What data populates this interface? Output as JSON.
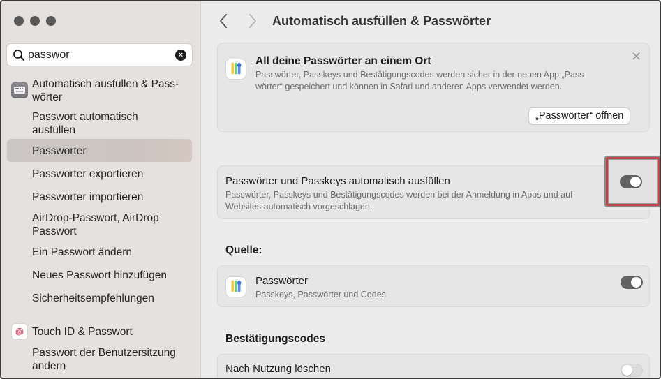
{
  "window": {
    "traffic_lights": [
      "close",
      "minimize",
      "zoom"
    ]
  },
  "sidebar": {
    "search": {
      "value": "passwor",
      "icon": "search-icon",
      "clear_icon": "clear-icon"
    },
    "group1": {
      "label": "Automatisch ausfüllen & Pass-\nwörter",
      "line1": "Automatisch ausfüllen & Pass-",
      "line2": "wörter",
      "icon": "keyboard-icon"
    },
    "items": [
      {
        "line1": "Passwort automatisch",
        "line2": "ausfüllen"
      },
      {
        "line1": "Passwörter"
      },
      {
        "line1": "Passwörter exportieren"
      },
      {
        "line1": "Passwörter importieren"
      },
      {
        "line1": "AirDrop-Passwort, AirDrop",
        "line2": "Passwort"
      },
      {
        "line1": "Ein Passwort ändern"
      },
      {
        "line1": "Neues Passwort hinzufügen"
      },
      {
        "line1": "Sicherheitsempfehlungen"
      }
    ],
    "group2": {
      "label": "Touch ID & Passwort",
      "icon": "fingerprint-icon"
    },
    "group2_items": [
      {
        "line1": "Passwort der Benutzersitzung",
        "line2": "ändern"
      }
    ]
  },
  "header": {
    "title": "Automatisch ausfüllen & Passwörter",
    "back_icon": "chevron-left-icon",
    "forward_icon": "chevron-right-icon"
  },
  "info_card": {
    "title": "All deine Passwörter an einem Ort",
    "desc_line1": "Passwörter, Passkeys und Bestätigungscodes werden sicher in der neuen App „Pass-",
    "desc_line2": "wörter“ gespeichert und können in Safari und anderen Apps verwendet werden.",
    "button": "„Passwörter“ öffnen",
    "close": "✕"
  },
  "autofill": {
    "title": "Passwörter und Passkeys automatisch ausfüllen",
    "desc_line1": "Passwörter, Passkeys und Bestätigungscodes werden bei der Anmeldung in Apps und auf",
    "desc_line2": "Websites automatisch vorgeschlagen.",
    "enabled": true
  },
  "source": {
    "heading": "Quelle:",
    "app_name": "Passwörter",
    "app_sub": "Passkeys, Passwörter und Codes",
    "enabled": true
  },
  "codes": {
    "heading": "Bestätigungscodes",
    "row_label": "Nach Nutzung löschen",
    "enabled": false
  },
  "colors": {
    "highlight": "#c4424b",
    "toggle_on": "#626262",
    "selected": "#cbc7c4"
  }
}
